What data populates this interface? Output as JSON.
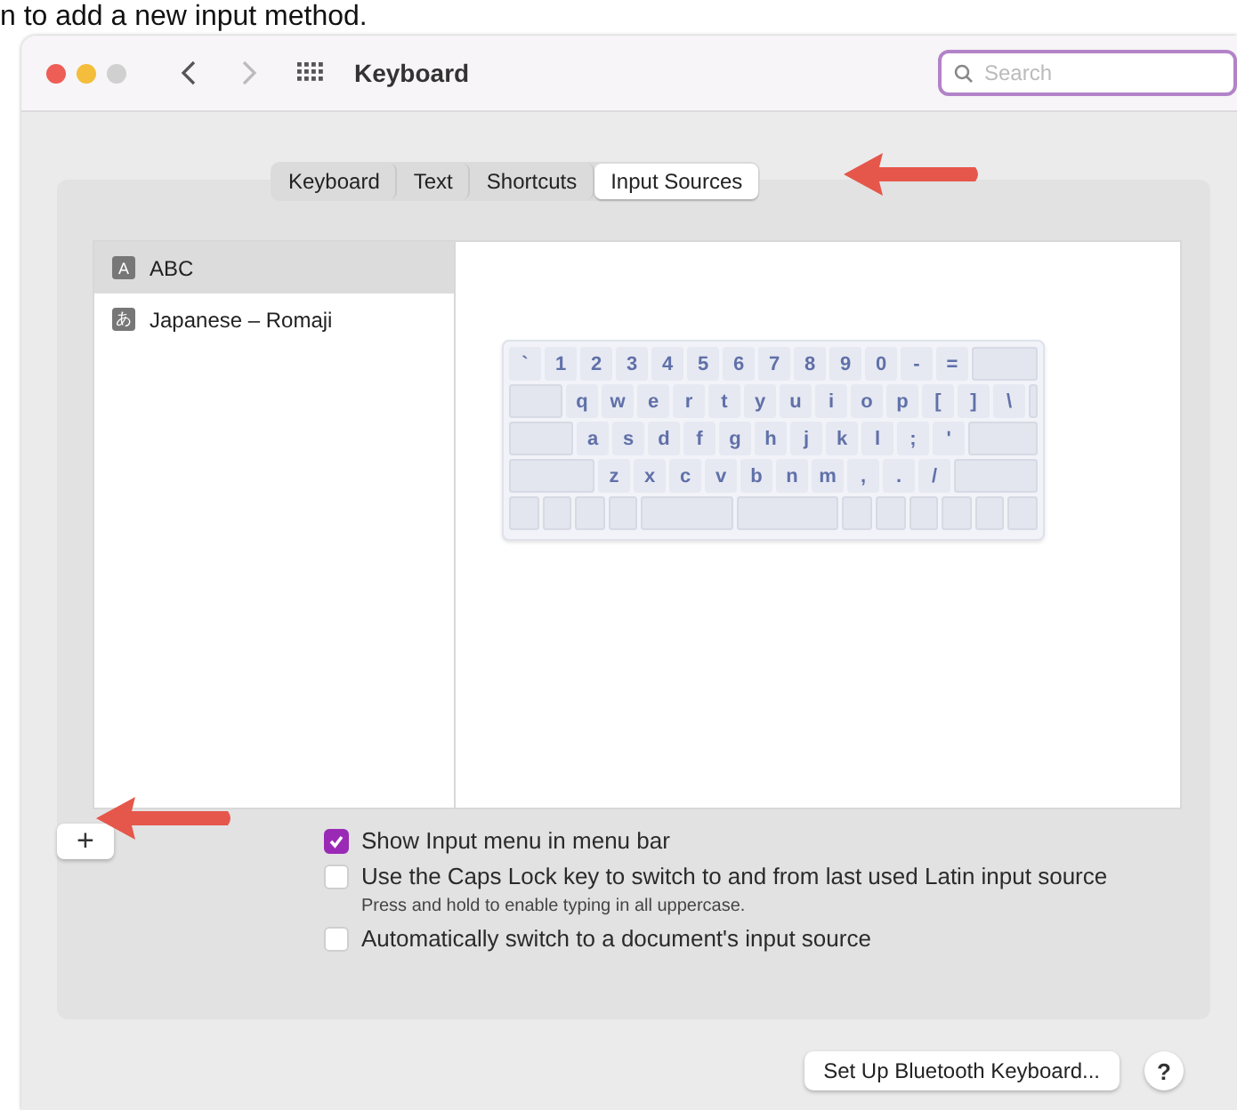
{
  "caption": "n to add a new input method.",
  "window": {
    "title": "Keyboard",
    "search": {
      "placeholder": "Search"
    }
  },
  "tabs": [
    {
      "label": "Keyboard",
      "selected": false
    },
    {
      "label": "Text",
      "selected": false
    },
    {
      "label": "Shortcuts",
      "selected": false
    },
    {
      "label": "Input Sources",
      "selected": true
    }
  ],
  "sources": [
    {
      "icon": "A",
      "name": "ABC",
      "selected": true
    },
    {
      "icon": "あ",
      "name": "Japanese – Romaji",
      "selected": false
    }
  ],
  "keyboard": [
    [
      "`",
      "1",
      "2",
      "3",
      "4",
      "5",
      "6",
      "7",
      "8",
      "9",
      "0",
      "-",
      "="
    ],
    [
      "q",
      "w",
      "e",
      "r",
      "t",
      "y",
      "u",
      "i",
      "o",
      "p",
      "[",
      "]",
      "\\"
    ],
    [
      "a",
      "s",
      "d",
      "f",
      "g",
      "h",
      "j",
      "k",
      "l",
      ";",
      "'"
    ],
    [
      "z",
      "x",
      "c",
      "v",
      "b",
      "n",
      "m",
      ",",
      ".",
      "/"
    ]
  ],
  "add_button": "+",
  "options": [
    {
      "label": "Show Input menu in menu bar",
      "checked": true
    },
    {
      "label": "Use the Caps Lock key to switch to and from last used Latin input source",
      "checked": false,
      "note": "Press and hold to enable typing in all uppercase."
    },
    {
      "label": "Automatically switch to a document's input source",
      "checked": false
    }
  ],
  "bluetooth_button": "Set Up Bluetooth Keyboard...",
  "help_button": "?"
}
